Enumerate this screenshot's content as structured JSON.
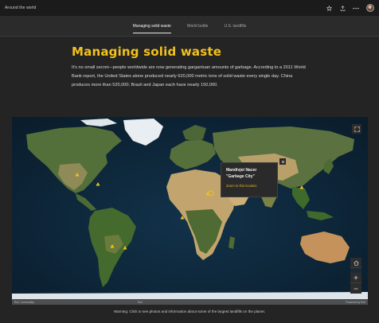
{
  "app": {
    "title": "Around the world"
  },
  "header_icons": [
    "star-icon",
    "share-icon",
    "more-icon",
    "avatar"
  ],
  "tabs": [
    {
      "label": "Managing solid waste",
      "active": true
    },
    {
      "label": "World bottle",
      "active": false
    },
    {
      "label": "U.S. landfills",
      "active": false
    }
  ],
  "article": {
    "title": "Managing solid waste",
    "body": "It's no small secret—people worldwide are now generating gargantuan amounts of garbage. According to a 2011 World Bank report, the United States alone produced nearly 620,000 metric tons of solid waste every single day. China produces more than 520,000; Brazil and Japan each have nearly 150,000."
  },
  "map": {
    "popup": {
      "title": "Mandivjet Nacer",
      "subtitle": "\"Garbage City\"",
      "link": "Zoom to this location"
    },
    "attribution_left": "Esri, Community",
    "attribution_mid": "Esri",
    "attribution_right": "Powered by Esri",
    "colors": {
      "ocean": "#0d2436",
      "land": "#4d6a35",
      "desert": "#c2a56e",
      "ice": "#e9eef2",
      "marker": "#f2c11d"
    }
  },
  "caption": "Warning: Click to see photos and information about some of the largest landfills on the planet."
}
